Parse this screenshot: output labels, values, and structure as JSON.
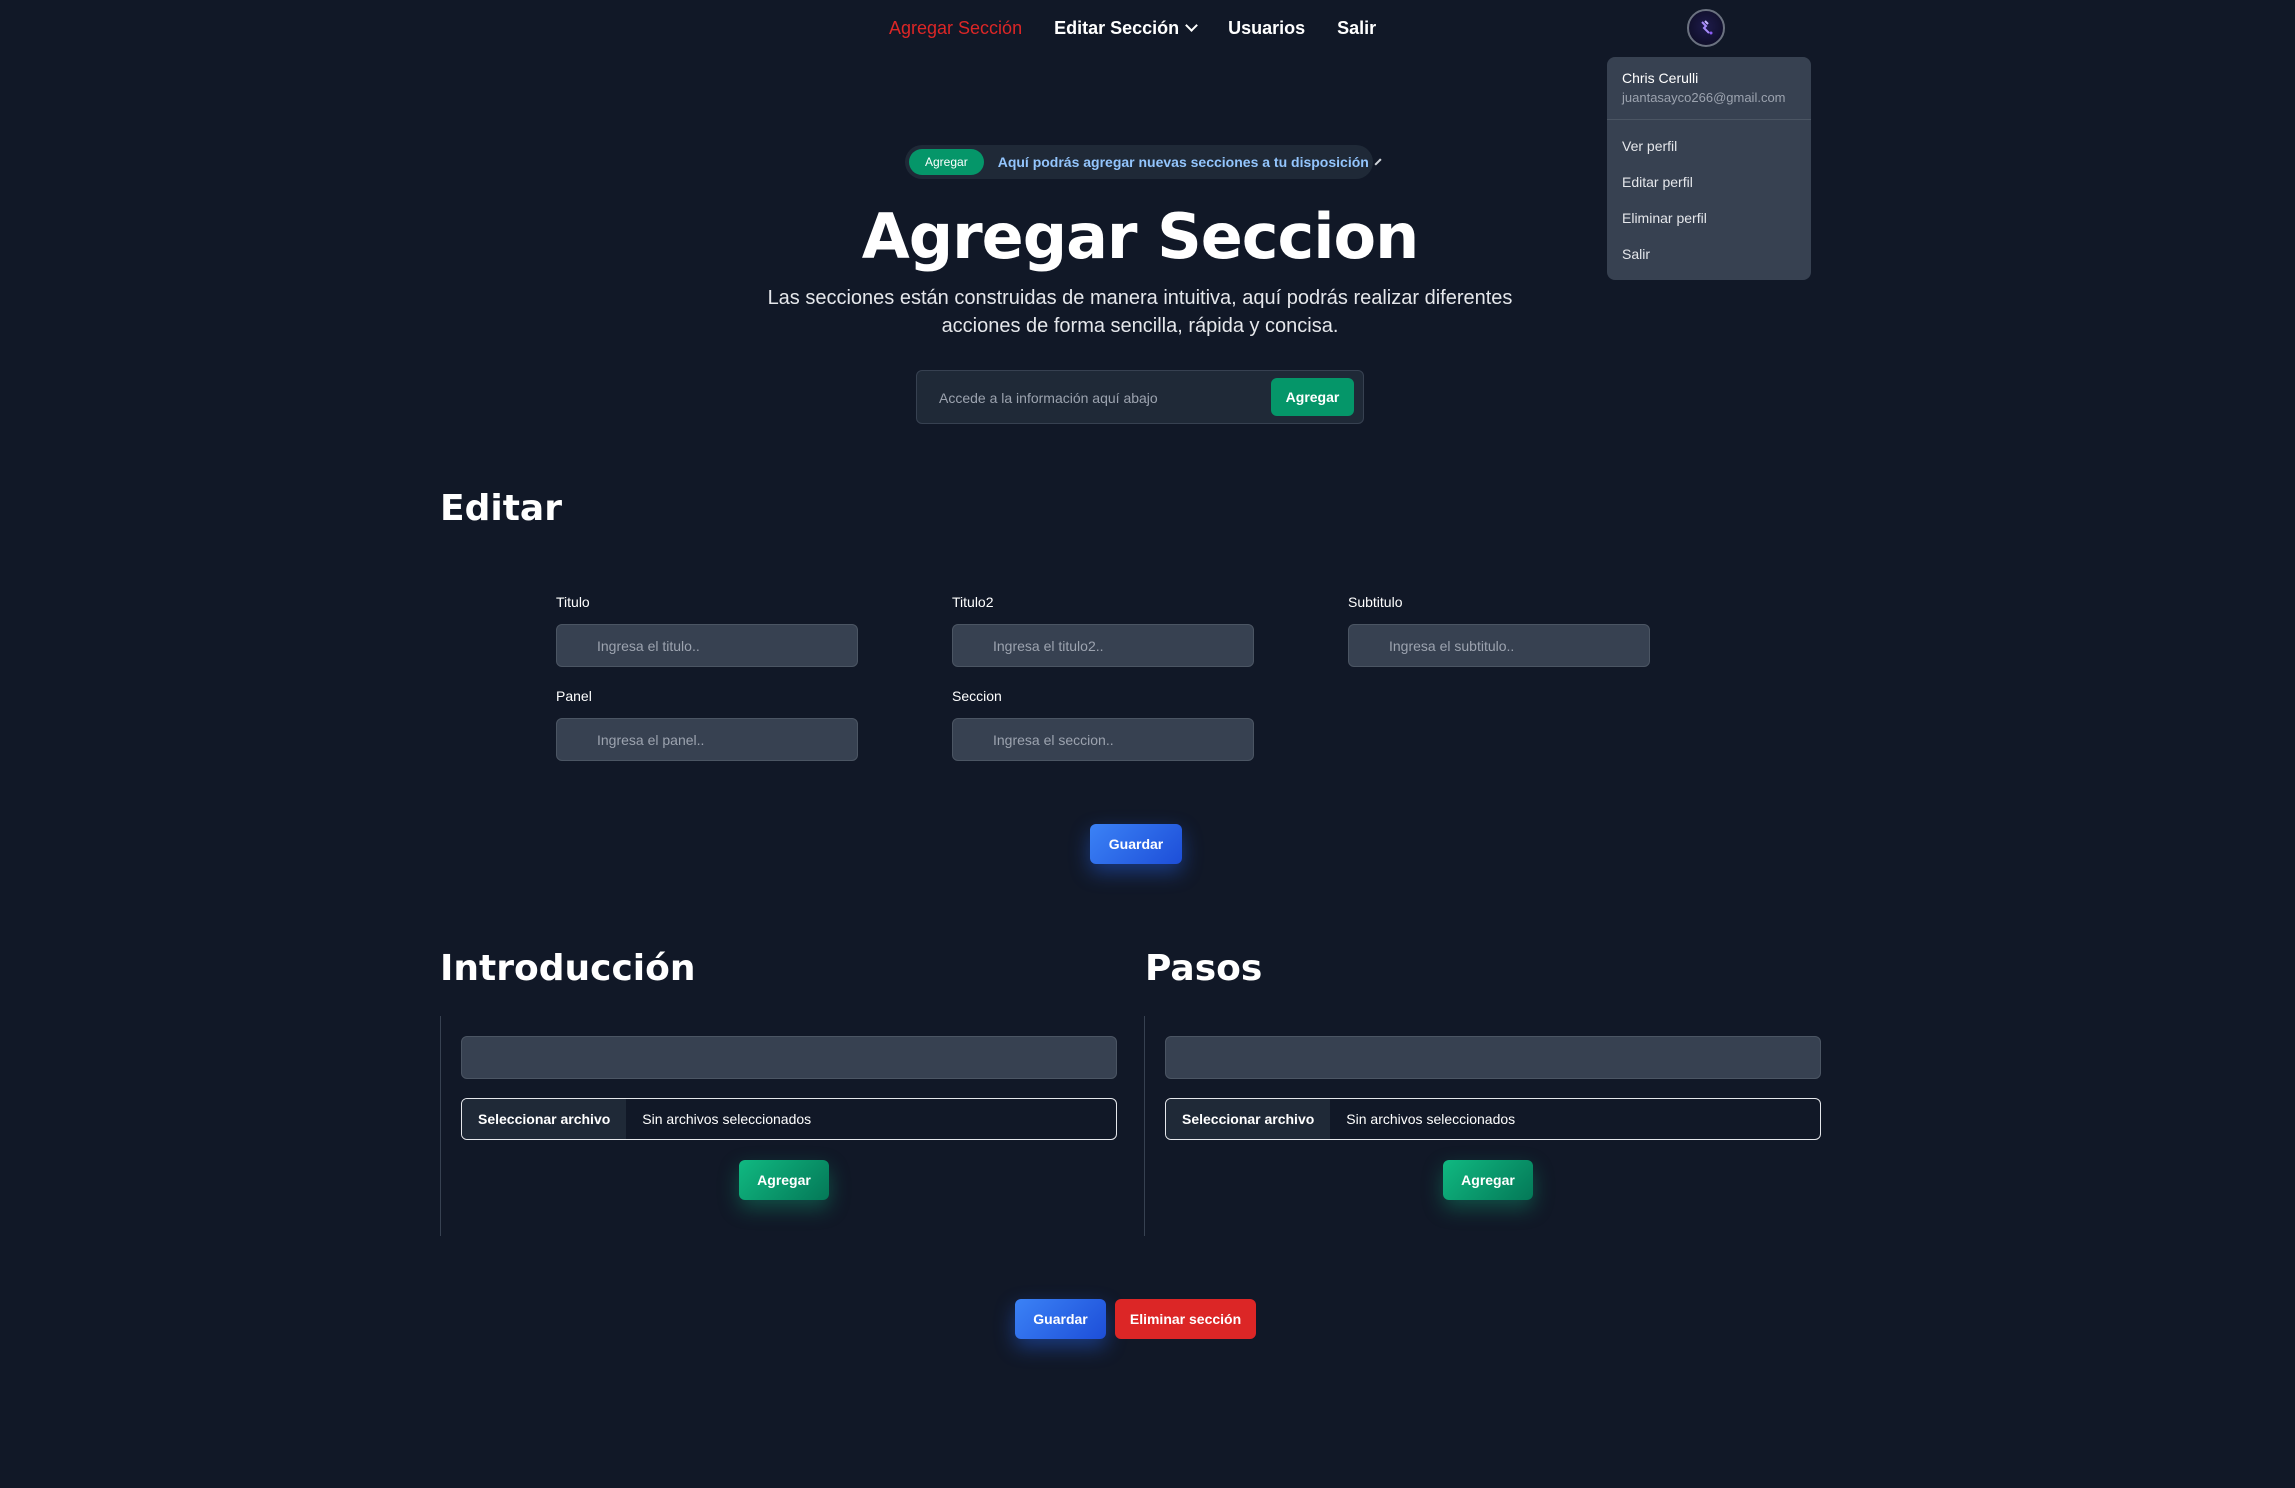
{
  "nav": {
    "items": [
      {
        "label": "Agregar Sección",
        "active": true
      },
      {
        "label": "Editar Sección",
        "dropdown": true
      },
      {
        "label": "Usuarios"
      },
      {
        "label": "Salir"
      }
    ]
  },
  "user_menu": {
    "name": "Chris Cerulli",
    "email": "juantasayco266@gmail.com",
    "items": [
      "Ver perfil",
      "Editar perfil",
      "Eliminar perfil",
      "Salir"
    ]
  },
  "hero": {
    "badge": "Agregar",
    "banner_text": "Aquí podrás agregar nuevas secciones a tu disposición",
    "title": "Agregar Seccion",
    "subtitle": "Las secciones están construidas de manera intuitiva, aquí podrás realizar diferentes acciones de forma sencilla, rápida y concisa.",
    "search_placeholder": "Accede a la información aquí abajo",
    "search_button": "Agregar"
  },
  "editar": {
    "heading": "Editar",
    "fields": [
      {
        "label": "Titulo",
        "placeholder": "Ingresa el titulo.."
      },
      {
        "label": "Titulo2",
        "placeholder": "Ingresa el titulo2.."
      },
      {
        "label": "Subtitulo",
        "placeholder": "Ingresa el subtitulo.."
      },
      {
        "label": "Panel",
        "placeholder": "Ingresa el panel.."
      },
      {
        "label": "Seccion",
        "placeholder": "Ingresa el seccion.."
      }
    ],
    "save_button": "Guardar"
  },
  "introduccion": {
    "heading": "Introducción",
    "input_value": "",
    "file_button": "Seleccionar archivo",
    "file_status": "Sin archivos seleccionados",
    "add_button": "Agregar"
  },
  "pasos": {
    "heading": "Pasos",
    "input_value": "",
    "file_button": "Seleccionar archivo",
    "file_status": "Sin archivos seleccionados",
    "add_button": "Agregar"
  },
  "footer_actions": {
    "save_button": "Guardar",
    "delete_button": "Eliminar sección"
  },
  "colors": {
    "background": "#111827",
    "active_nav": "#dc2626",
    "green": "#059669",
    "blue": "#2563eb",
    "red": "#dc2626"
  }
}
